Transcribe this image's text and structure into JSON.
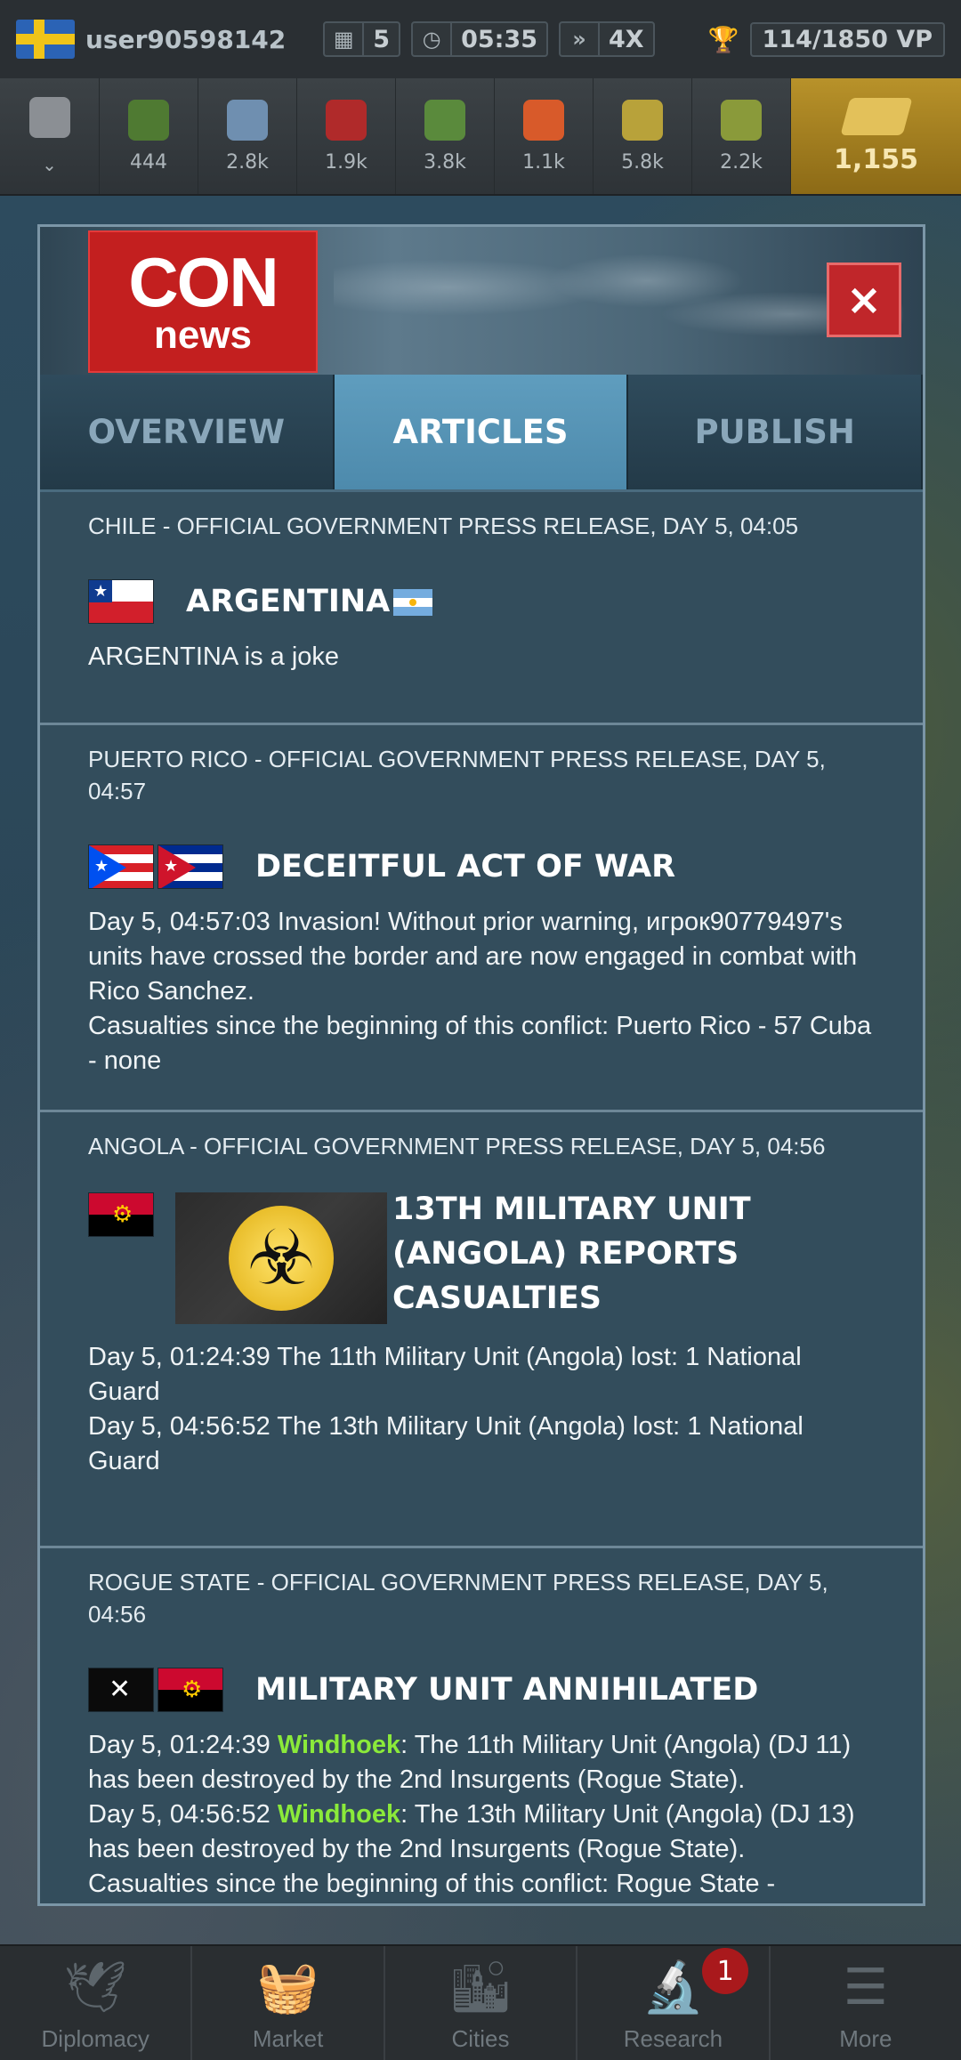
{
  "topbar": {
    "username": "user90598142",
    "day": "5",
    "time": "05:35",
    "speed": "4X",
    "vp": "114/1850 VP"
  },
  "resources": [
    {
      "name": "supplies",
      "value": "444",
      "color": "#4f7a32"
    },
    {
      "name": "components",
      "value": "2.8k",
      "color": "#6f8fb0"
    },
    {
      "name": "manpower",
      "value": "1.9k",
      "color": "#b02a2a"
    },
    {
      "name": "rare-materials",
      "value": "3.8k",
      "color": "#5a8a3c"
    },
    {
      "name": "fuel",
      "value": "1.1k",
      "color": "#d85a2a"
    },
    {
      "name": "electronics",
      "value": "5.8k",
      "color": "#b8a23a"
    },
    {
      "name": "money",
      "value": "2.2k",
      "color": "#8a9a3a"
    }
  ],
  "gold": "1,155",
  "panel": {
    "logo_top": "CON",
    "logo_bottom": "news",
    "close": "×",
    "tabs": [
      {
        "label": "OVERVIEW",
        "active": false
      },
      {
        "label": "ARTICLES",
        "active": true
      },
      {
        "label": "PUBLISH",
        "active": false
      }
    ]
  },
  "articles": [
    {
      "header": "CHILE - OFFICIAL GOVERNMENT PRESS RELEASE, DAY 5, 04:05",
      "title": "ARGENTINA",
      "body": [
        "ARGENTINA is a joke"
      ]
    },
    {
      "header": "PUERTO RICO - OFFICIAL GOVERNMENT PRESS RELEASE, DAY 5, 04:57",
      "title": "DECEITFUL ACT OF WAR",
      "body": [
        "Day 5, 04:57:03 Invasion! Without prior warning, игрок90779497's units have crossed the border and are now engaged in combat with Rico Sanchez.",
        "Casualties since the beginning of this conflict: Puerto Rico - 57 Cuba - none"
      ]
    },
    {
      "header": "ANGOLA - OFFICIAL GOVERNMENT PRESS RELEASE, DAY 5, 04:56",
      "title": "13TH MILITARY UNIT (ANGOLA) REPORTS CASUALTIES",
      "body": [
        "Day 5, 01:24:39 The 11th Military Unit (Angola) lost: 1 National Guard",
        "Day 5, 04:56:52 The 13th Military Unit (Angola) lost: 1 National Guard"
      ]
    },
    {
      "header": "ROGUE STATE - OFFICIAL GOVERNMENT PRESS RELEASE, DAY 5, 04:56",
      "title": "MILITARY UNIT ANNIHILATED",
      "lines": [
        {
          "prefix": "Day 5, 01:24:39 ",
          "city": "Windhoek",
          "rest": ": The 11th Military Unit (Angola) (DJ 11) has been destroyed by the 2nd Insurgents (Rogue State)."
        },
        {
          "prefix": "Day 5, 04:56:52 ",
          "city": "Windhoek",
          "rest": ": The 13th Military Unit (Angola) (DJ 13) has been destroyed by the 2nd Insurgents (Rogue State)."
        }
      ],
      "tail": "Casualties since the beginning of this conflict: Rogue State -"
    }
  ],
  "nav": [
    {
      "label": "Diplomacy",
      "icon": "🕊"
    },
    {
      "label": "Market",
      "icon": "🧺"
    },
    {
      "label": "Cities",
      "icon": "🏙"
    },
    {
      "label": "Research",
      "icon": "🔬",
      "badge": "1"
    },
    {
      "label": "More",
      "icon": "☰"
    }
  ]
}
